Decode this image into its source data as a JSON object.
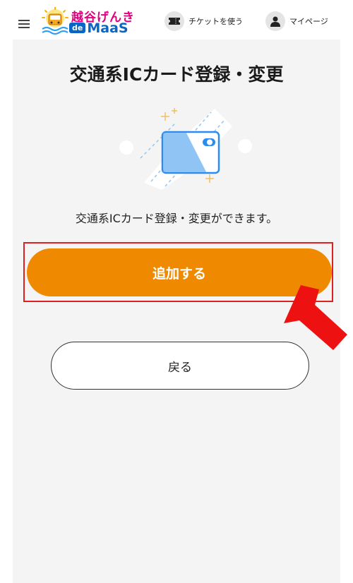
{
  "header": {
    "logo_text_top": "越谷げんき",
    "logo_text_de": "de",
    "logo_text_maas": "MaaS",
    "ticket_label": "チケットを使う",
    "mypage_label": "マイページ"
  },
  "main": {
    "title": "交通系ICカード登録・変更",
    "description": "交通系ICカード登録・変更ができます。",
    "add_button_label": "追加する",
    "back_button_label": "戻る"
  },
  "colors": {
    "accent": "#ef8a00",
    "highlight": "#e02020",
    "arrow": "#ee1111",
    "card_blue": "#2b8cf0"
  }
}
